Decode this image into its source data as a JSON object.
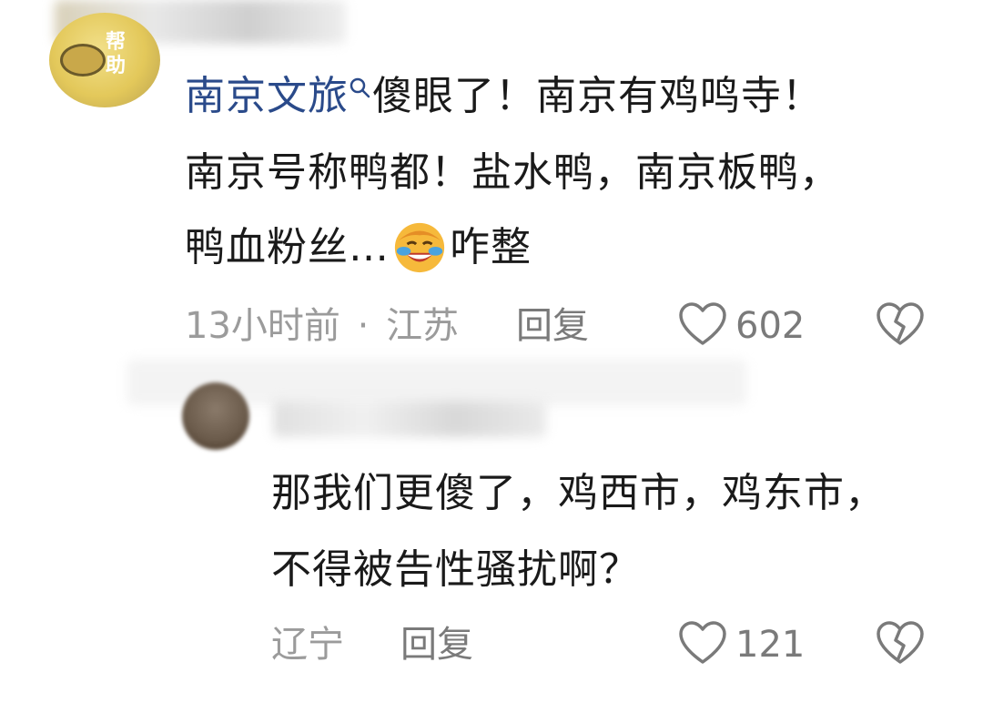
{
  "comment1": {
    "author": "南京文旅",
    "line1_text": "傻眼了！南京有鸡鸣寺！",
    "line2": "南京号称鸭都！盐水鸭，南京板鸭，",
    "line3_pre": "鸭血粉丝…",
    "line3_post": "咋整",
    "emoji": "laughing-crying-emoji",
    "time": "13小时前",
    "sep": "·",
    "location": "江苏",
    "reply_label": "回复",
    "likes": "602"
  },
  "comment2": {
    "line1": "那我们更傻了，鸡西市，鸡东市，",
    "line2": "不得被告性骚扰啊？",
    "location": "辽宁",
    "reply_label": "回复",
    "likes": "121"
  },
  "colors": {
    "author_link": "#2a4a8a",
    "meta_gray": "#9b9b9b",
    "reply_gray": "#7a7a7a"
  }
}
